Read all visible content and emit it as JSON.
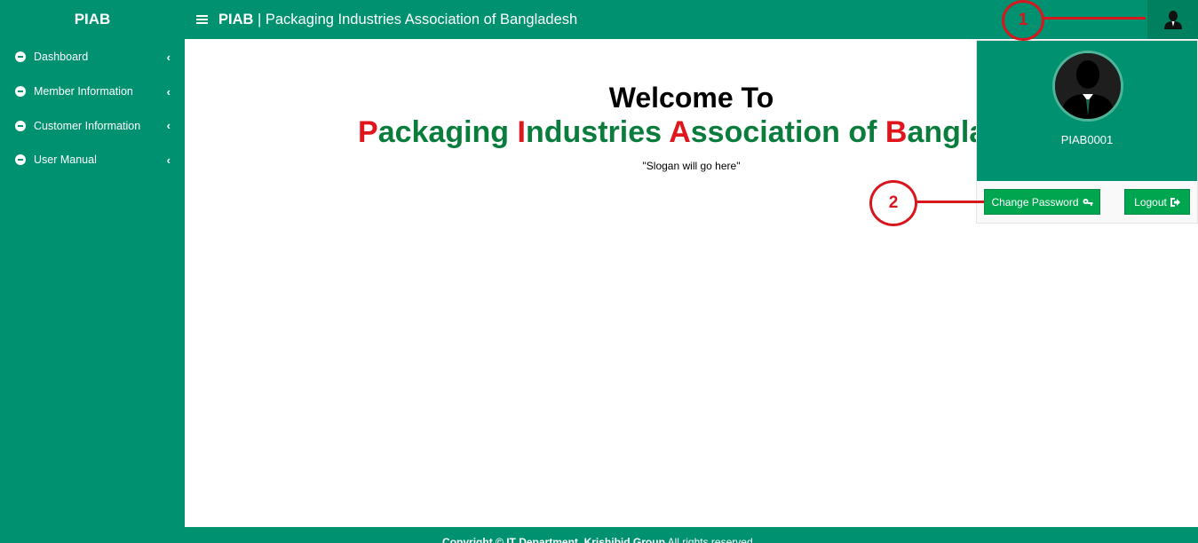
{
  "app": {
    "brand": "PIAB",
    "title_bold": "PIAB",
    "title_rest": " | Packaging Industries Association of Bangladesh"
  },
  "sidebar": {
    "items": [
      {
        "label": "Dashboard",
        "icon": "minus-circle-icon"
      },
      {
        "label": "Member Information",
        "icon": "minus-circle-icon"
      },
      {
        "label": "Customer Information",
        "icon": "minus-circle-icon"
      },
      {
        "label": "User Manual",
        "icon": "minus-circle-icon"
      }
    ]
  },
  "main": {
    "welcome": "Welcome To",
    "org_parts": [
      {
        "text": "P",
        "red": true
      },
      {
        "text": "ackaging ",
        "red": false
      },
      {
        "text": "I",
        "red": true
      },
      {
        "text": "ndustries ",
        "red": false
      },
      {
        "text": "A",
        "red": true
      },
      {
        "text": "ssociation of ",
        "red": false
      },
      {
        "text": "B",
        "red": true
      },
      {
        "text": "angladesh",
        "red": false
      }
    ],
    "slogan": "\"Slogan will go here\""
  },
  "user_menu": {
    "username": "PIAB0001",
    "change_password": "Change Password",
    "logout": "Logout"
  },
  "annotations": {
    "marker_1": "1",
    "marker_2": "2"
  },
  "footer": {
    "copyright_bold": "Copyright © IT Department, Krishibid Group",
    "copyright_rest": " All rights reserved."
  },
  "colors": {
    "primary": "#009170",
    "button_green": "#00a550",
    "accent_red": "#e1151c",
    "org_green": "#0a7d3c"
  }
}
